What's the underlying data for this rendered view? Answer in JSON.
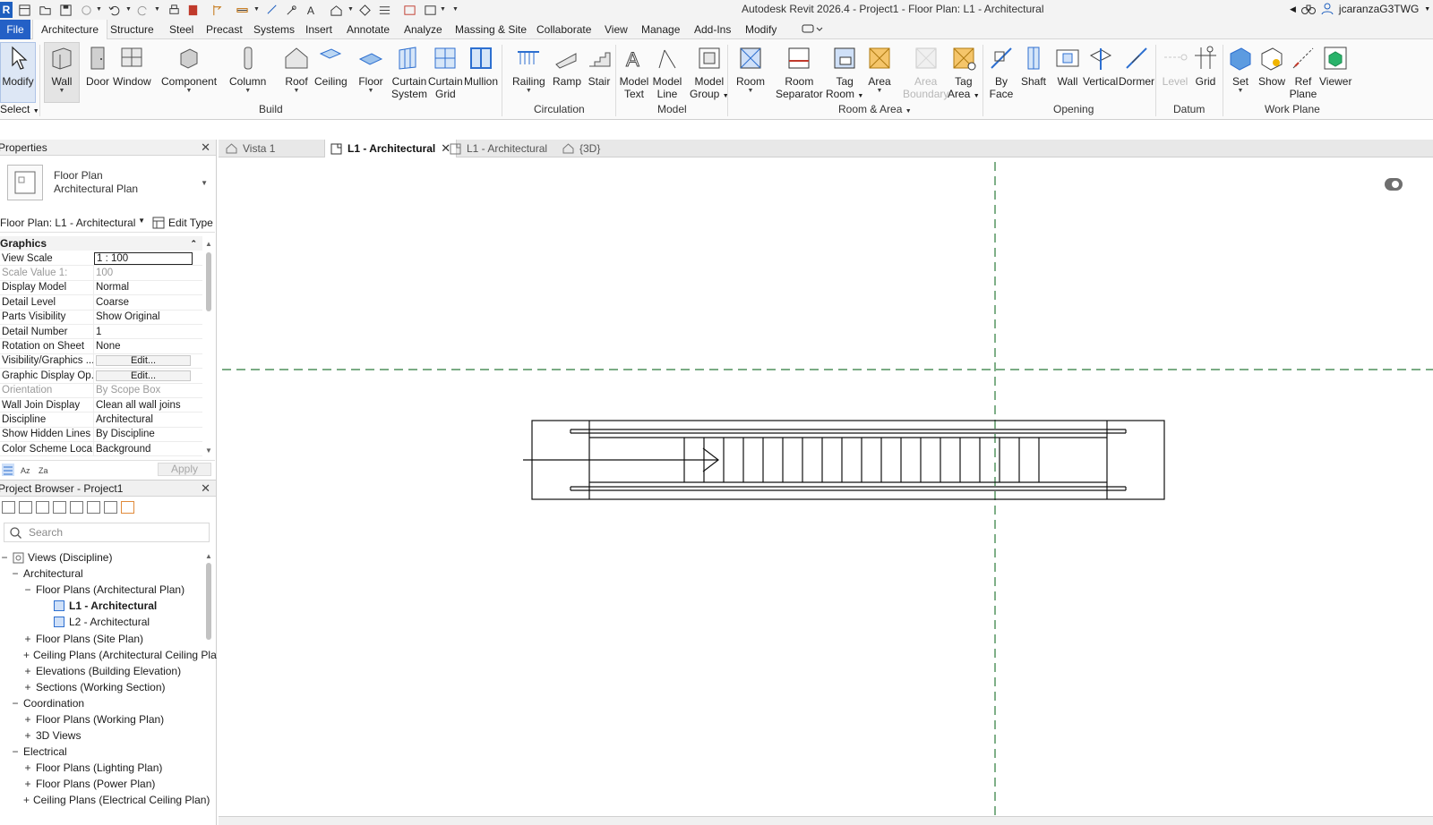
{
  "window": {
    "title": "Autodesk Revit 2026.4 - Project1 - Floor Plan: L1 - Architectural",
    "user": "jcaranzaG3TWG"
  },
  "ribbon_tabs": [
    "File",
    "Architecture",
    "Structure",
    "Steel",
    "Precast",
    "Systems",
    "Insert",
    "Annotate",
    "Analyze",
    "Massing & Site",
    "Collaborate",
    "View",
    "Manage",
    "Add-Ins",
    "Modify"
  ],
  "ribbon": {
    "select": {
      "label": "Select",
      "modify": "Modify"
    },
    "build": {
      "label": "Build",
      "wall": "Wall",
      "door": "Door",
      "window": "Window",
      "component": "Component",
      "column": "Column",
      "roof": "Roof",
      "ceiling": "Ceiling",
      "floor": "Floor",
      "curtain_system": [
        "Curtain",
        "System"
      ],
      "curtain_grid": [
        "Curtain",
        "Grid"
      ],
      "mullion": "Mullion"
    },
    "circulation": {
      "label": "Circulation",
      "railing": "Railing",
      "ramp": "Ramp",
      "stair": "Stair"
    },
    "model": {
      "label": "Model",
      "model_text": [
        "Model",
        "Text"
      ],
      "model_line": [
        "Model",
        "Line"
      ],
      "model_group": [
        "Model",
        "Group"
      ]
    },
    "room_area": {
      "label": "Room & Area",
      "room": "Room",
      "room_separator": [
        "Room",
        "Separator"
      ],
      "tag_room": [
        "Tag",
        "Room"
      ],
      "area": "Area",
      "area_boundary": [
        "Area",
        "Boundary"
      ],
      "tag_area": [
        "Tag",
        "Area"
      ]
    },
    "opening": {
      "label": "Opening",
      "by_face": [
        "By",
        "Face"
      ],
      "shaft": "Shaft",
      "wall": "Wall",
      "vertical": "Vertical",
      "dormer": "Dormer"
    },
    "datum": {
      "label": "Datum",
      "level": "Level",
      "grid": "Grid"
    },
    "work_plane": {
      "label": "Work Plane",
      "set": "Set",
      "show": "Show",
      "ref_plane": [
        "Ref",
        "Plane"
      ],
      "viewer": "Viewer"
    }
  },
  "properties": {
    "title": "Properties",
    "type_family": "Floor Plan",
    "type_name": "Architectural Plan",
    "instance_selector": "Floor Plan: L1 - Architectural",
    "edit_type": "Edit Type",
    "section": "Graphics",
    "rows": [
      {
        "name": "View Scale",
        "value": "1 : 100"
      },
      {
        "name": "Scale Value    1:",
        "value": "100"
      },
      {
        "name": "Display Model",
        "value": "Normal"
      },
      {
        "name": "Detail Level",
        "value": "Coarse"
      },
      {
        "name": "Parts Visibility",
        "value": "Show Original"
      },
      {
        "name": "Detail Number",
        "value": "1"
      },
      {
        "name": "Rotation on Sheet",
        "value": "None"
      },
      {
        "name": "Visibility/Graphics ...",
        "value": "Edit..."
      },
      {
        "name": "Graphic Display Op...",
        "value": "Edit..."
      },
      {
        "name": "Orientation",
        "value": "By Scope Box"
      },
      {
        "name": "Wall Join Display",
        "value": "Clean all wall joins"
      },
      {
        "name": "Discipline",
        "value": "Architectural"
      },
      {
        "name": "Show Hidden Lines",
        "value": "By Discipline"
      },
      {
        "name": "Color Scheme Loca...",
        "value": "Background"
      }
    ],
    "apply": "Apply"
  },
  "project_browser": {
    "title": "Project Browser - Project1",
    "search_placeholder": "Search",
    "tree": [
      {
        "label": "Views (Discipline)",
        "toggle": "−"
      },
      {
        "label": "Architectural",
        "toggle": "−"
      },
      {
        "label": "Floor Plans (Architectural Plan)",
        "toggle": "−"
      },
      {
        "label": "L1 - Architectural",
        "toggle": ""
      },
      {
        "label": "L2 - Architectural",
        "toggle": ""
      },
      {
        "label": "Floor Plans (Site Plan)",
        "toggle": "+"
      },
      {
        "label": "Ceiling Plans (Architectural Ceiling Pla",
        "toggle": "+"
      },
      {
        "label": "Elevations (Building Elevation)",
        "toggle": "+"
      },
      {
        "label": "Sections (Working Section)",
        "toggle": "+"
      },
      {
        "label": "Coordination",
        "toggle": "−"
      },
      {
        "label": "Floor Plans (Working Plan)",
        "toggle": "+"
      },
      {
        "label": "3D Views",
        "toggle": "+"
      },
      {
        "label": "Electrical",
        "toggle": "−"
      },
      {
        "label": "Floor Plans (Lighting Plan)",
        "toggle": "+"
      },
      {
        "label": "Floor Plans (Power Plan)",
        "toggle": "+"
      },
      {
        "label": "Ceiling Plans (Electrical Ceiling Plan)",
        "toggle": "+"
      }
    ]
  },
  "view_tabs": [
    {
      "label": "Vista 1"
    },
    {
      "label": "L1 - Architectural"
    },
    {
      "label": "L1 - Architectural"
    },
    {
      "label": "{3D}"
    }
  ],
  "colors": {
    "accent": "#2460c6",
    "guide_line": "#2a7a3a",
    "ribbon_bg": "#fafafa"
  }
}
